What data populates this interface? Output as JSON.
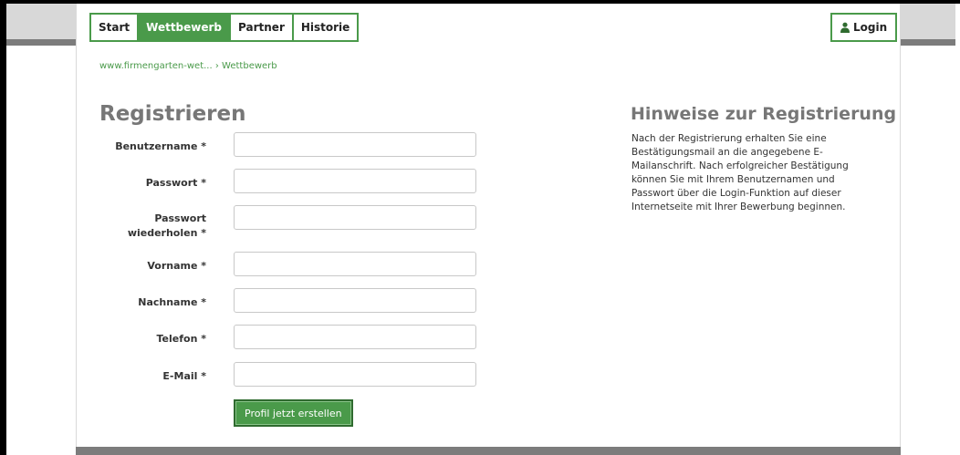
{
  "nav": {
    "tabs": [
      {
        "label": "Start"
      },
      {
        "label": "Wettbewerb"
      },
      {
        "label": "Partner"
      },
      {
        "label": "Historie"
      }
    ],
    "login_label": "Login"
  },
  "breadcrumb": {
    "home": "www.firmengarten-wet...",
    "separator": "›",
    "current": "Wettbewerb"
  },
  "form": {
    "title": "Registrieren",
    "fields": [
      {
        "label": "Benutzername *",
        "value": ""
      },
      {
        "label": "Passwort *",
        "value": ""
      },
      {
        "label": "Passwort wiederholen *",
        "value": ""
      },
      {
        "label": "Vorname *",
        "value": ""
      },
      {
        "label": "Nachname *",
        "value": ""
      },
      {
        "label": "Telefon *",
        "value": ""
      },
      {
        "label": "E-Mail *",
        "value": ""
      }
    ],
    "submit_label": "Profil jetzt erstellen"
  },
  "hints": {
    "title": "Hinweise zur Registrierung",
    "text": "Nach der Registrierung erhalten Sie eine Bestätigungsmail an die angegebene E-Mailanschrift. Nach erfolgreicher Bestätigung können Sie mit Ihrem Benutzernamen und Passwort über die Login-Funktion auf dieser Internetseite mit Ihrer Bewerbung beginnen."
  },
  "colors": {
    "accent": "#4a9a4a",
    "accent_dark": "#2f6b2f",
    "heading_gray": "#777777",
    "bar_gray": "#7c7c7c"
  },
  "icons": {
    "login": "user-icon"
  }
}
